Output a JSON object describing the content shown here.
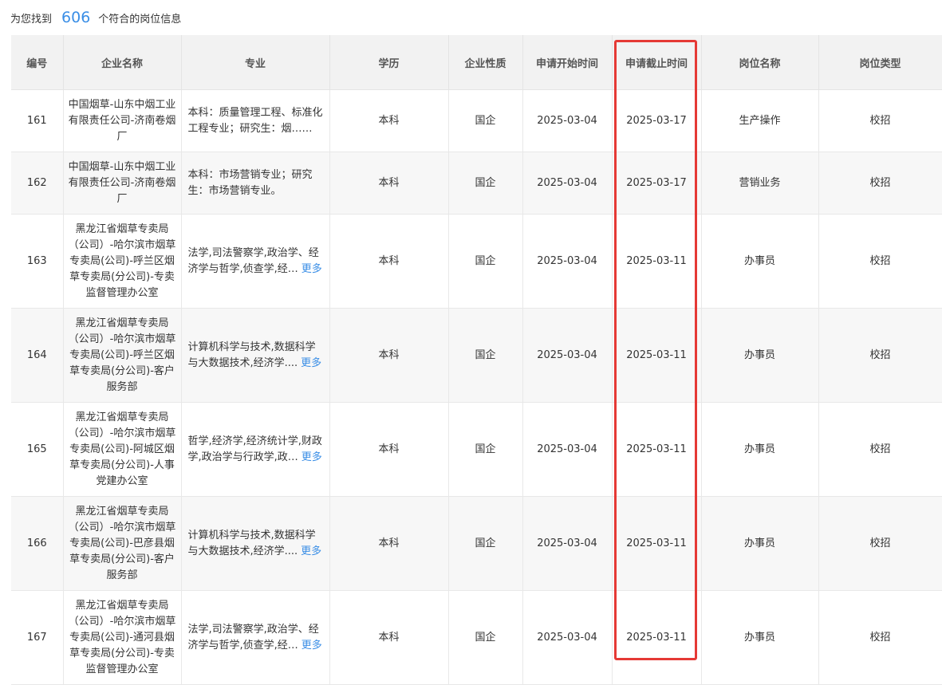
{
  "summary": {
    "prefix": "为您找到",
    "count": "606",
    "suffix": "个符合的岗位信息"
  },
  "columns": [
    "编号",
    "企业名称",
    "专业",
    "学历",
    "企业性质",
    "申请开始时间",
    "申请截止时间",
    "岗位名称",
    "岗位类型"
  ],
  "more_label": "更多",
  "highlight_color": "#e53935",
  "link_color": "#3a8ee6",
  "rows": [
    {
      "id": "161",
      "company": "中国烟草-山东中烟工业有限责任公司-济南卷烟厂",
      "major": "本科：质量管理工程、标准化工程专业；研究生：烟…",
      "has_more": true,
      "degree": "本科",
      "nature": "国企",
      "start": "2025-03-04",
      "end": "2025-03-17",
      "position": "生产操作",
      "type": "校招"
    },
    {
      "id": "162",
      "company": "中国烟草-山东中烟工业有限责任公司-济南卷烟厂",
      "major": "本科：市场营销专业；研究生：市场营销专业。",
      "has_more": false,
      "degree": "本科",
      "nature": "国企",
      "start": "2025-03-04",
      "end": "2025-03-17",
      "position": "营销业务",
      "type": "校招"
    },
    {
      "id": "163",
      "company": "黑龙江省烟草专卖局（公司）-哈尔滨市烟草专卖局(公司)-呼兰区烟草专卖局(分公司)-专卖监督管理办公室",
      "major": "法学,司法警察学,政治学、经济学与哲学,侦查学,经…",
      "has_more": true,
      "degree": "本科",
      "nature": "国企",
      "start": "2025-03-04",
      "end": "2025-03-11",
      "position": "办事员",
      "type": "校招"
    },
    {
      "id": "164",
      "company": "黑龙江省烟草专卖局（公司）-哈尔滨市烟草专卖局(公司)-呼兰区烟草专卖局(分公司)-客户服务部",
      "major": "计算机科学与技术,数据科学与大数据技术,经济学....",
      "has_more": true,
      "degree": "本科",
      "nature": "国企",
      "start": "2025-03-04",
      "end": "2025-03-11",
      "position": "办事员",
      "type": "校招"
    },
    {
      "id": "165",
      "company": "黑龙江省烟草专卖局（公司）-哈尔滨市烟草专卖局(公司)-阿城区烟草专卖局(分公司)-人事党建办公室",
      "major": "哲学,经济学,经济统计学,财政学,政治学与行政学,政…",
      "has_more": true,
      "degree": "本科",
      "nature": "国企",
      "start": "2025-03-04",
      "end": "2025-03-11",
      "position": "办事员",
      "type": "校招"
    },
    {
      "id": "166",
      "company": "黑龙江省烟草专卖局（公司）-哈尔滨市烟草专卖局(公司)-巴彦县烟草专卖局(分公司)-客户服务部",
      "major": "计算机科学与技术,数据科学与大数据技术,经济学....",
      "has_more": true,
      "degree": "本科",
      "nature": "国企",
      "start": "2025-03-04",
      "end": "2025-03-11",
      "position": "办事员",
      "type": "校招"
    },
    {
      "id": "167",
      "company": "黑龙江省烟草专卖局（公司）-哈尔滨市烟草专卖局(公司)-通河县烟草专卖局(分公司)-专卖监督管理办公室",
      "major": "法学,司法警察学,政治学、经济学与哲学,侦查学,经…",
      "has_more": true,
      "degree": "本科",
      "nature": "国企",
      "start": "2025-03-04",
      "end": "2025-03-11",
      "position": "办事员",
      "type": "校招"
    }
  ]
}
